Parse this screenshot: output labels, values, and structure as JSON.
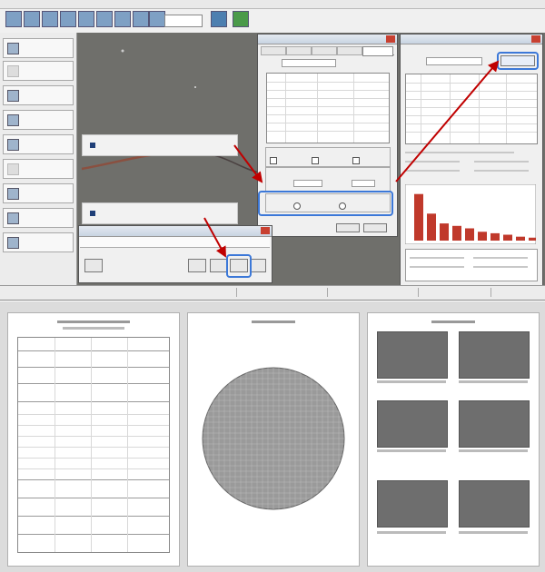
{
  "colors": {
    "highlight_box": "#3c78d8",
    "arrow_red": "#c00000",
    "histogram_bar": "#c0392b",
    "image_gray": "#6f6f6b",
    "filter_membrane": "#9a9a9a"
  },
  "icons": {
    "toolbar": [
      "open-icon",
      "save-icon",
      "save-as-icon",
      "image-icon",
      "zoom-icon",
      "edit-icon",
      "grid-icon",
      "measure-icon",
      "mark-icon",
      "monitor-icon",
      "msa-icon"
    ],
    "sidebar": [
      "connect-camera-icon",
      "calibrate-icon",
      "new-open-icon",
      "project-settings-icon",
      "dynamic-image-icon",
      "stitch-icon",
      "image-sequence-icon",
      "threshold-icon",
      "statistics-icon"
    ]
  },
  "histogram": {
    "values": [
      0.95,
      0.55,
      0.35,
      0.3,
      0.25,
      0.18,
      0.15,
      0.12,
      0.08,
      0.06
    ]
  },
  "report_pages": {
    "grid_cells": 26,
    "thumbnails": 6
  }
}
